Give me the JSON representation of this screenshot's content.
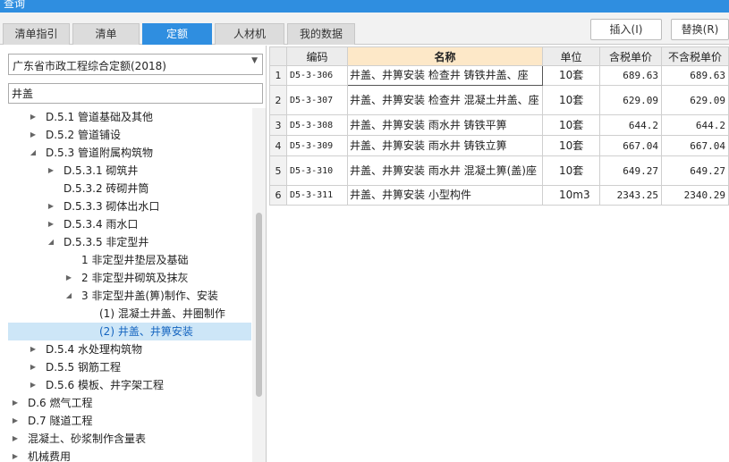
{
  "window": {
    "title": "查询"
  },
  "tabs": [
    {
      "label": "清单指引"
    },
    {
      "label": "清单"
    },
    {
      "label": "定额"
    },
    {
      "label": "人材机"
    },
    {
      "label": "我的数据"
    }
  ],
  "active_tab": "定额",
  "buttons": {
    "insert": "插入(I)",
    "replace": "替换(R)"
  },
  "quota_select": {
    "value": "广东省市政工程综合定额(2018)"
  },
  "search": {
    "value": "井盖"
  },
  "tree": [
    {
      "label": "D.5.1 管道基础及其他",
      "toggle": "▶"
    },
    {
      "label": "D.5.2 管道铺设",
      "toggle": "▶"
    },
    {
      "label": "D.5.3 管道附属构筑物",
      "toggle": "◢"
    },
    {
      "label": "D.5.3.1 砌筑井",
      "toggle": "▶"
    },
    {
      "label": "D.5.3.2 砖砌井筒",
      "toggle": ""
    },
    {
      "label": "D.5.3.3 砌体出水口",
      "toggle": "▶"
    },
    {
      "label": "D.5.3.4 雨水口",
      "toggle": "▶"
    },
    {
      "label": "D.5.3.5 非定型井",
      "toggle": "◢"
    },
    {
      "label": "1 非定型井垫层及基础",
      "toggle": ""
    },
    {
      "label": "2 非定型井砌筑及抹灰",
      "toggle": "▶"
    },
    {
      "label": "3 非定型井盖(箅)制作、安装",
      "toggle": "◢"
    },
    {
      "label": "(1) 混凝土井盖、井圈制作",
      "toggle": ""
    },
    {
      "label": "(2) 井盖、井箅安装",
      "toggle": ""
    },
    {
      "label": "D.5.4 水处理构筑物",
      "toggle": "▶"
    },
    {
      "label": "D.5.5 钢筋工程",
      "toggle": "▶"
    },
    {
      "label": "D.5.6 模板、井字架工程",
      "toggle": "▶"
    },
    {
      "label": "D.6 燃气工程",
      "toggle": "▶"
    },
    {
      "label": "D.7 隧道工程",
      "toggle": "▶"
    },
    {
      "label": "混凝土、砂浆制作含量表",
      "toggle": "▶"
    },
    {
      "label": "机械费用",
      "toggle": "▶"
    }
  ],
  "table": {
    "headers": [
      "",
      "编码",
      "名称",
      "单位",
      "含税单价",
      "不含税单价"
    ],
    "rows": [
      {
        "index": "1",
        "code": "D5-3-306",
        "name": "井盖、井箅安装 检查井 铸铁井盖、座",
        "unit": "10套",
        "price_tax": "689.63",
        "price_notax": "689.63"
      },
      {
        "index": "2",
        "code": "D5-3-307",
        "name": "井盖、井箅安装 检查井 混凝土井盖、座",
        "unit": "10套",
        "price_tax": "629.09",
        "price_notax": "629.09"
      },
      {
        "index": "3",
        "code": "D5-3-308",
        "name": "井盖、井箅安装 雨水井 铸铁平箅",
        "unit": "10套",
        "price_tax": "644.2",
        "price_notax": "644.2"
      },
      {
        "index": "4",
        "code": "D5-3-309",
        "name": "井盖、井箅安装 雨水井 铸铁立箅",
        "unit": "10套",
        "price_tax": "667.04",
        "price_notax": "667.04"
      },
      {
        "index": "5",
        "code": "D5-3-310",
        "name": "井盖、井箅安装 雨水井 混凝土箅(盖)座",
        "unit": "10套",
        "price_tax": "649.27",
        "price_notax": "649.27"
      },
      {
        "index": "6",
        "code": "D5-3-311",
        "name": "井盖、井箅安装 小型构件",
        "unit": "10m3",
        "price_tax": "2343.25",
        "price_notax": "2340.29"
      }
    ]
  },
  "colors": {
    "accent": "#2f8ee0",
    "header_highlight": "#fde8c8",
    "selected_row": "#cde6f7"
  }
}
